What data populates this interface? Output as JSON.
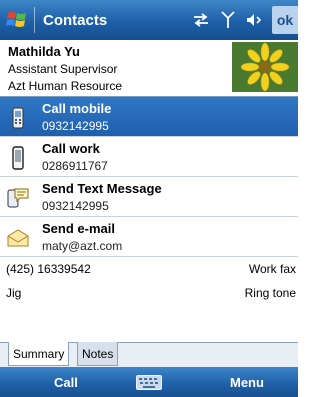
{
  "titlebar": {
    "title": "Contacts",
    "ok_label": "ok",
    "icons": [
      "start-flag-icon",
      "connectivity-icon",
      "signal-icon",
      "volume-icon"
    ]
  },
  "contact": {
    "name": "Mathilda Yu",
    "job_title": "Assistant Supervisor",
    "company": "Azt Human Resource"
  },
  "actions": [
    {
      "label": "Call mobile",
      "value": "0932142995",
      "icon": "mobile-phone-icon",
      "selected": true
    },
    {
      "label": "Call work",
      "value": "0286911767",
      "icon": "work-phone-icon",
      "selected": false
    },
    {
      "label": "Send Text Message",
      "value": "0932142995",
      "icon": "text-message-icon",
      "selected": false
    },
    {
      "label": "Send e-mail",
      "value": "maty@azt.com",
      "icon": "email-icon",
      "selected": false
    }
  ],
  "fields": [
    {
      "value": "(425) 16339542",
      "label": "Work fax"
    },
    {
      "value": "Jig",
      "label": "Ring tone"
    }
  ],
  "tabs": [
    {
      "label": "Summary",
      "active": true
    },
    {
      "label": "Notes",
      "active": false
    }
  ],
  "softkeys": {
    "left": "Call",
    "right": "Menu",
    "center_icon": "keyboard-icon"
  },
  "colors": {
    "titlebar": "#1d5fa8",
    "selection": "#2f77c5",
    "tab_bar": "#e9eef4"
  }
}
